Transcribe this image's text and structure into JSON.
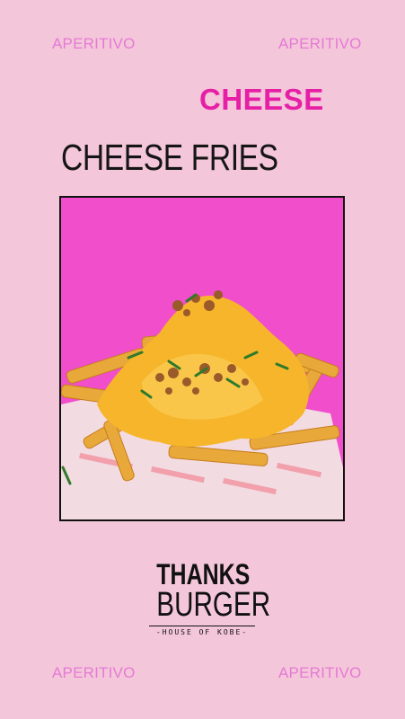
{
  "corners": {
    "top_left": "APERITIVO",
    "top_right": "APERITIVO",
    "bottom_left": "APERITIVO",
    "bottom_right": "APERITIVO"
  },
  "headline": "CHEESE",
  "title": "CHEESE FRIES",
  "logo": {
    "line1": "THANKS",
    "line2": "BURGER",
    "tagline": "-HOUSE OF KOBE-"
  },
  "colors": {
    "background": "#f4c6d9",
    "accent_pink": "#e61fa6",
    "corner_text": "#e57ad6",
    "photo_background": "#f24fc9",
    "cheese": "#f6b52a",
    "fries": "#e9a93a"
  }
}
